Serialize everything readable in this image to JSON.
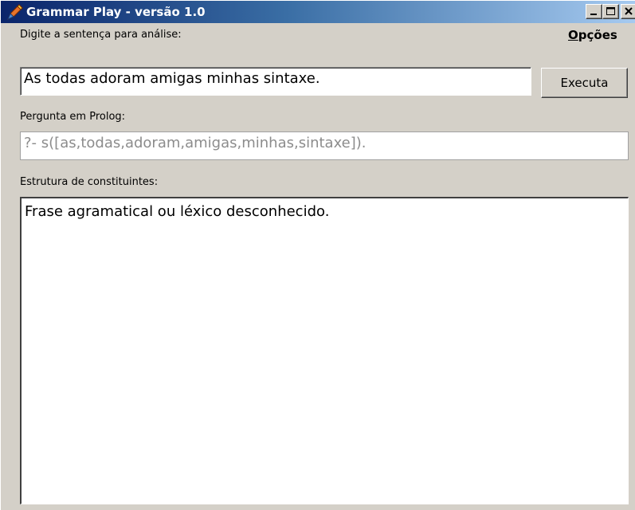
{
  "window": {
    "title": "Grammar Play - versão 1.0",
    "controls": {
      "minimize_icon": "minimize-icon",
      "maximize_icon": "maximize-icon",
      "close_icon": "close-icon"
    }
  },
  "input_section": {
    "label": "Digite a sentença para análise:",
    "value": "As todas adoram amigas minhas sintaxe."
  },
  "options_menu": {
    "first": "O",
    "rest": "pções"
  },
  "execute_button": {
    "label": "Executa"
  },
  "prolog_section": {
    "label": "Pergunta em Prolog:",
    "value": "?- s([as,todas,adoram,amigas,minhas,sintaxe])."
  },
  "structure_section": {
    "label": "Estrutura de constituintes:",
    "value": "Frase agramatical ou léxico desconhecido."
  },
  "colors": {
    "titlebar_start": "#0a246a",
    "titlebar_end": "#a6caf0",
    "window_bg": "#d4d0c8"
  }
}
